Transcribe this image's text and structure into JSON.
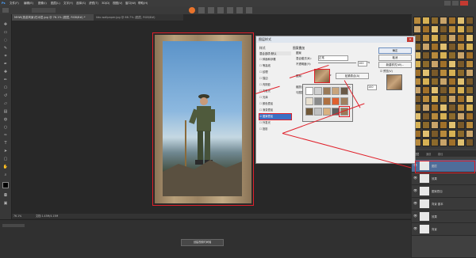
{
  "menubar": {
    "logo": "Ps",
    "items": [
      "文件(F)",
      "编辑(E)",
      "图像(I)",
      "图层(L)",
      "文字(Y)",
      "选择(S)",
      "滤镜(T)",
      "3D(D)",
      "视图(V)",
      "窗口(W)",
      "帮助(H)"
    ],
    "window_title": "图层样式 - 编辑图层图层样式"
  },
  "document": {
    "tab_label": "MHW(旅游风景)在冰层.jpg @ 76.1% (图层, RGB/8#) *",
    "tab2_label": "lidx.wallpaper.jpg @ 66.7% (图层, RGB/8#)"
  },
  "status": {
    "zoom": "76.1%",
    "doc_size": "文档:1.43M/4.15M"
  },
  "timeline": {
    "create_button": "创建视频时间轴"
  },
  "dialog": {
    "title": "图层样式",
    "styles_header": "样式",
    "blend_options": "混合选项:默认",
    "style_items": [
      "斜面和浮雕",
      "等高线",
      "纹理",
      "描边",
      "内阴影",
      "内发光",
      "光泽",
      "颜色叠加",
      "渐变叠加",
      "图案叠加",
      "外发光",
      "投影"
    ],
    "pattern_section_title": "图案叠加",
    "pattern_label": "图案",
    "blend_mode_label": "混合模式(B):",
    "blend_mode_value": "正常",
    "opacity_label": "不透明度(Y):",
    "opacity_value": "100",
    "percent": "%",
    "pattern_field_label": "图案:",
    "snap_button": "贴紧原点(A)",
    "scale_label": "缩放(S):",
    "scale_value": "100",
    "link_label": "与图层链接(K)",
    "buttons": {
      "ok": "确定",
      "cancel": "取消",
      "new_style": "新建样式(W)...",
      "preview": "预览(V)"
    }
  },
  "layers_panel": {
    "tabs": [
      "图层",
      "通道",
      "路径"
    ],
    "layers": [
      {
        "name": "图层",
        "selected": true
      },
      {
        "name": "效果"
      },
      {
        "name": "图案叠加"
      },
      {
        "name": "背景 副本"
      },
      {
        "name": "效果"
      },
      {
        "name": "背景"
      }
    ]
  },
  "colors": {
    "accent_red": "#e0202a",
    "selection_blue": "#3b6fc4",
    "dialog_bg": "#f0f0f0"
  }
}
